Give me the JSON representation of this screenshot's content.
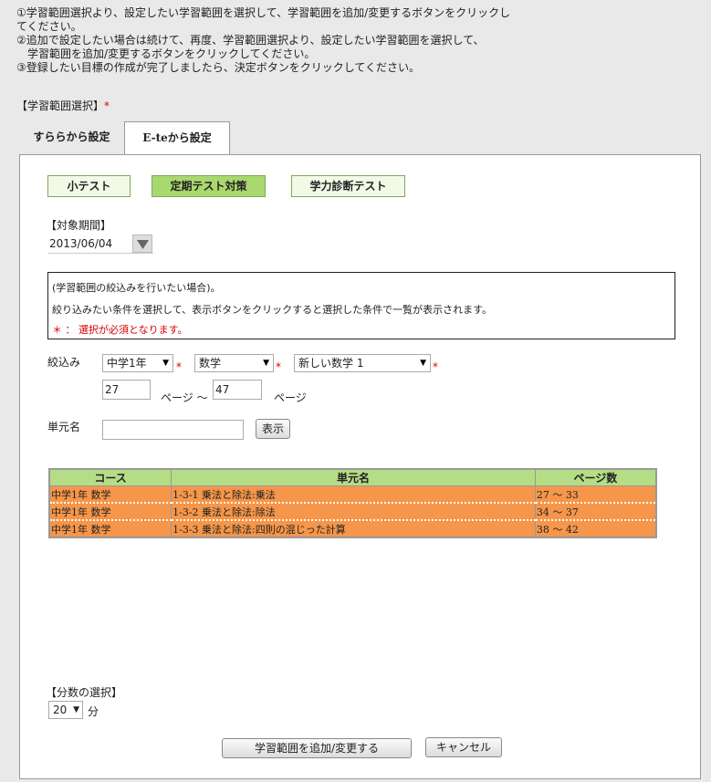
{
  "instructions": [
    "①学習範囲選択より、設定したい学習範囲を選択して、学習範囲を追加/変更するボタンをクリックし",
    "てください。",
    "②追加で設定したい場合は続けて、再度、学習範囲選択より、設定したい学習範囲を選択して、",
    "　学習範囲を追加/変更するボタンをクリックしてください。",
    "③登録したい目標の作成が完了しましたら、決定ボタンをクリックしてください。"
  ],
  "section_label": "【学習範囲選択】",
  "required_mark": "*",
  "tabs": [
    {
      "label": "すららから設定",
      "active": false
    },
    {
      "label": "E-teから設定",
      "active": true
    }
  ],
  "subtabs": [
    {
      "label": "小テスト",
      "selected": false
    },
    {
      "label": "定期テスト対策",
      "selected": true
    },
    {
      "label": "学力診断テスト",
      "selected": false
    }
  ],
  "period": {
    "label": "【対象期間】",
    "date": "2013/06/04",
    "dropdown_icon": "triangle-down-icon"
  },
  "notice": {
    "line1": "(学習範囲の絞込みを行いたい場合)。",
    "line2": "絞り込みたい条件を選択して、表示ボタンをクリックすると選択した条件で一覧が表示されます。",
    "line3": "＊ ： 選択が必須となります。"
  },
  "filter": {
    "label": "絞込み",
    "grade": "中学1年",
    "subject": "数学",
    "textbook": "新しい数学 1",
    "page_from": "27",
    "page_to": "47",
    "page_unit": "ページ",
    "range_sep": "ページ ～"
  },
  "unit_search": {
    "label": "単元名",
    "value": "",
    "button": "表示"
  },
  "table": {
    "headers": [
      "コース",
      "単元名",
      "ページ数"
    ],
    "rows": [
      [
        "中学1年 数学",
        "1-3-1 乗法と除法:乗法",
        "27 ～ 33"
      ],
      [
        "中学1年 数学",
        "1-3-2 乗法と除法:除法",
        "34 ～ 37"
      ],
      [
        "中学1年 数学",
        "1-3-3 乗法と除法:四則の混じった計算",
        "38 ～ 42"
      ]
    ],
    "row_color": "#f5964a",
    "header_color": "#b5dd85"
  },
  "minutes": {
    "label": "【分数の選択】",
    "value": "20",
    "unit": "分"
  },
  "actions": {
    "add_label": "学習範囲を追加/変更する",
    "cancel_label": "キャンセル"
  }
}
